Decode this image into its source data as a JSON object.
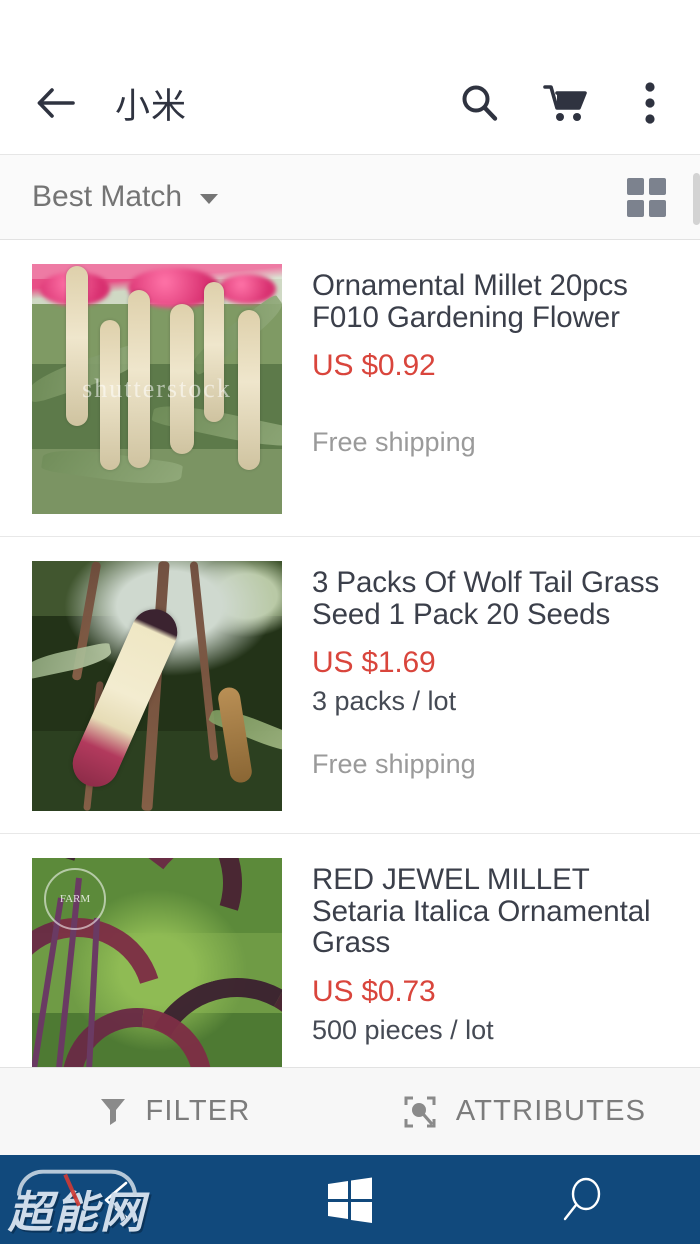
{
  "appbar": {
    "back_icon": "arrow-left-icon",
    "title": "小米",
    "search_icon": "search-icon",
    "cart_icon": "shopping-cart-icon",
    "overflow_icon": "more-vertical-icon"
  },
  "sortbar": {
    "sort_label": "Best Match",
    "caret_icon": "chevron-down-icon",
    "grid_toggle_icon": "grid-view-icon"
  },
  "products": [
    {
      "title": "Ornamental Millet 20pcs F010 Gardening Flower",
      "price": "US $0.92",
      "lot": "",
      "shipping": "Free shipping",
      "image_alt": "ornamental-millet-plants",
      "image_watermark": "shutterstock"
    },
    {
      "title": "3 Packs Of Wolf Tail Grass Seed 1 Pack 20 Seeds",
      "price": "US $1.69",
      "lot": "3 packs / lot",
      "shipping": "Free shipping",
      "image_alt": "wolf-tail-grass-seed-head",
      "image_watermark": ""
    },
    {
      "title": "RED JEWEL MILLET Setaria Italica Ornamental Grass",
      "price": "US $0.73",
      "lot": "500 pieces / lot",
      "shipping": "",
      "image_alt": "red-jewel-millet-grass",
      "image_watermark": "FARM"
    }
  ],
  "actionbar": {
    "filter_label": "FILTER",
    "filter_icon": "funnel-icon",
    "attributes_label": "ATTRIBUTES",
    "attributes_icon": "scan-search-icon"
  },
  "navbar": {
    "back_icon": "nav-back-arrow-icon",
    "home_icon": "windows-logo-icon",
    "search_icon": "nav-search-icon",
    "watermark_text": "超能网"
  },
  "colors": {
    "price_red": "#d9453c",
    "nav_blue": "#11497c",
    "title_dark": "#3b3f4a",
    "muted_gray": "#9a9a9a"
  }
}
